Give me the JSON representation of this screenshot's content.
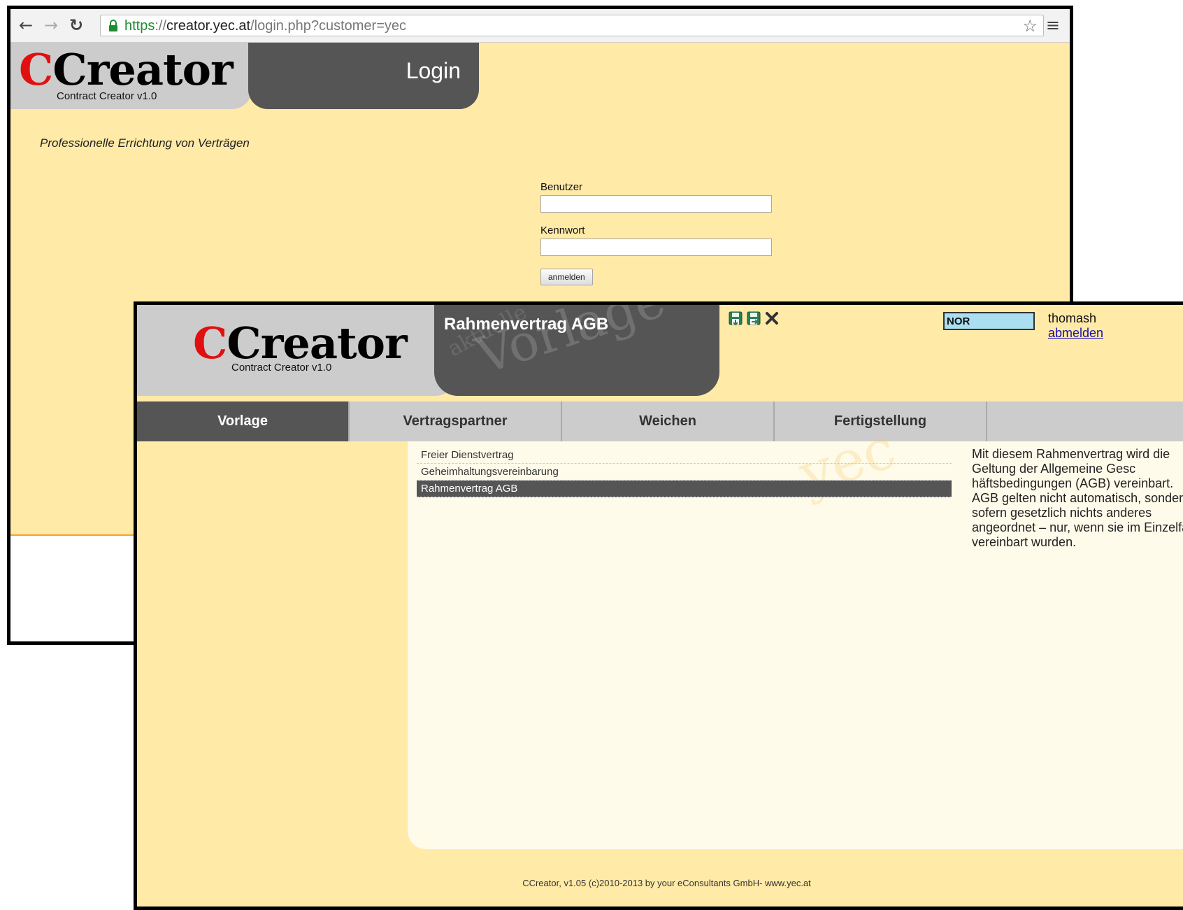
{
  "browser": {
    "url_scheme": "https",
    "url_separator": "://",
    "url_host": "creator.yec.at",
    "url_path": "/login.php?customer=yec"
  },
  "logo": {
    "initial": "C",
    "word": "Creator",
    "subtitle": "Contract Creator v1.0"
  },
  "login": {
    "title": "Login",
    "slogan": "Professionelle Errichtung von Verträgen",
    "user_label": "Benutzer",
    "password_label": "Kennwort",
    "submit_label": "anmelden"
  },
  "app": {
    "document_title": "Rahmenvertrag AGB",
    "watermark_small": "aktuelle",
    "watermark_big": "Vorlage",
    "language": "NOR",
    "username": "thomash",
    "logout_label": "abmelden",
    "tabs": [
      {
        "label": "Vorlage",
        "active": true
      },
      {
        "label": "Vertragspartner",
        "active": false
      },
      {
        "label": "Weichen",
        "active": false
      },
      {
        "label": "Fertigstellung",
        "active": false
      }
    ],
    "templates": [
      {
        "label": "Freier Dienstvertrag",
        "selected": false
      },
      {
        "label": "Geheimhaltungsvereinbarung",
        "selected": false
      },
      {
        "label": "Rahmenvertrag AGB",
        "selected": true
      }
    ],
    "description": "Mit diesem Rahmenvertrag wird die Geltung der Allgemeine Gesc häftsbedingungen (AGB) vereinbart. AGB gelten nicht automatisch, sondern – sofern gesetzlich nichts anderes angeordnet – nur, wenn sie im Einzelfall vereinbart wurden.",
    "content_watermark": "yec",
    "footer": "CCreator, v1.05 (c)2010-2013 by your eConsultants GmbH- www.yec.at"
  },
  "colors": {
    "page_bg": "#ffeaa7",
    "dark_tab": "#555555",
    "light_tab": "#cccccc",
    "logo_red": "#e01010",
    "lang_box": "#a9dff0",
    "link": "#1a0dab"
  },
  "icons": [
    "back-arrow-icon",
    "forward-arrow-icon",
    "reload-icon",
    "lock-icon",
    "bookmark-star-icon",
    "menu-icon",
    "save-icon",
    "save-as-icon",
    "close-icon"
  ]
}
